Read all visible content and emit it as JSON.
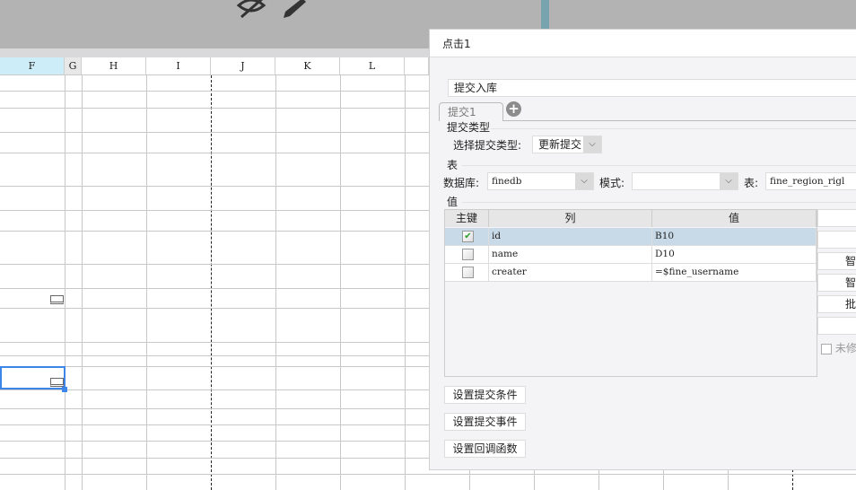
{
  "spreadsheet": {
    "columns": [
      "F",
      "G",
      "H",
      "I",
      "J",
      "K",
      "L"
    ],
    "selected_column": "F"
  },
  "toolbar": {
    "icons": [
      "eye-off-icon",
      "pencil-icon"
    ]
  },
  "dialog": {
    "title": "点击1",
    "name_value": "提交入库",
    "tab_label": "提交1",
    "submit_type": {
      "section": "提交类型",
      "label": "选择提交类型:",
      "value": "更新提交"
    },
    "table_section": {
      "section": "表",
      "db_label": "数据库:",
      "db_value": "finedb",
      "schema_label": "模式:",
      "schema_value": "",
      "table_label": "表:",
      "table_value": "fine_region_rigl"
    },
    "values": {
      "section": "值",
      "headers": [
        "主键",
        "列",
        "值"
      ],
      "rows": [
        {
          "key": true,
          "column": "id",
          "value": "B10"
        },
        {
          "key": false,
          "column": "name",
          "value": "D10"
        },
        {
          "key": false,
          "column": "creater",
          "value": "=$fine_username"
        }
      ]
    },
    "side_buttons": [
      "智",
      "",
      "智能",
      "智能",
      "批量",
      ""
    ],
    "unmodified_label": "未修",
    "buttons": [
      "设置提交条件",
      "设置提交事件",
      "设置回调函数"
    ]
  }
}
